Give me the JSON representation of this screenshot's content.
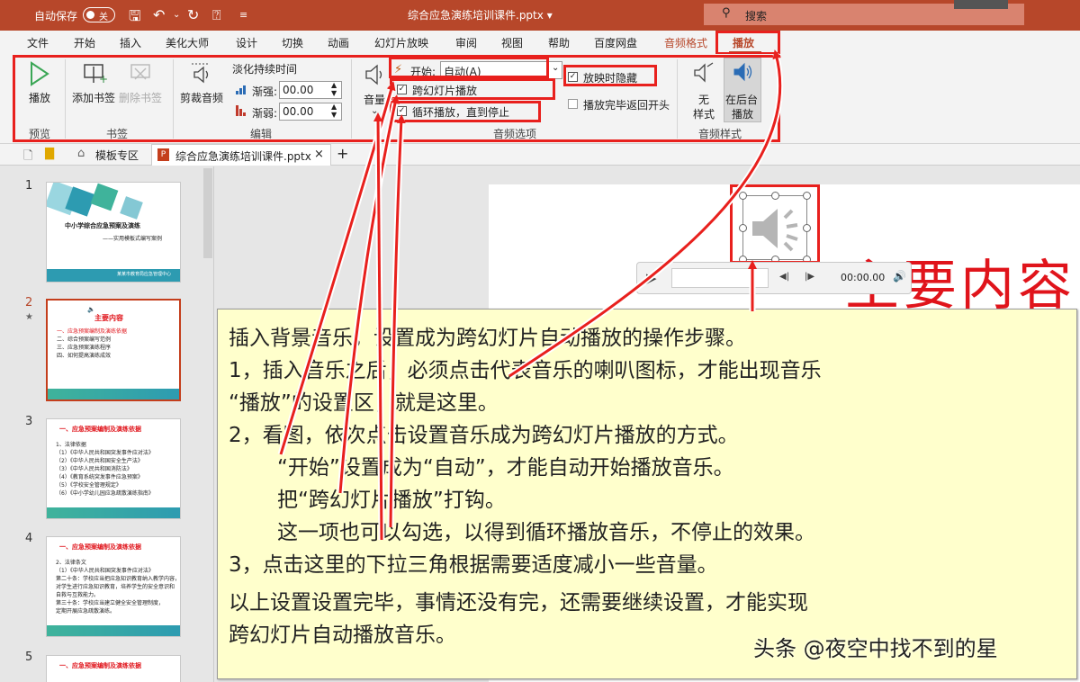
{
  "titlebar": {
    "autosave_label": "自动保存",
    "autosave_state": "关",
    "filename": "综合应急演练培训课件.pptx",
    "filename_chevron": "▾",
    "search_placeholder": "搜索"
  },
  "tabs": [
    {
      "label": "文件"
    },
    {
      "label": "开始"
    },
    {
      "label": "插入"
    },
    {
      "label": "美化大师"
    },
    {
      "label": "设计"
    },
    {
      "label": "切换"
    },
    {
      "label": "动画"
    },
    {
      "label": "幻灯片放映"
    },
    {
      "label": "审阅"
    },
    {
      "label": "视图"
    },
    {
      "label": "帮助"
    },
    {
      "label": "百度网盘"
    },
    {
      "label": "音频格式"
    },
    {
      "label": "播放"
    }
  ],
  "ribbon": {
    "play_label": "播放",
    "preview_group": "预览",
    "add_bookmark": "添加书签",
    "remove_bookmark": "删除书签",
    "bookmark_group": "书签",
    "trim_audio": "剪裁音频",
    "fade_title": "淡化持续时间",
    "fade_in_label": "渐强:",
    "fade_in_value": "00.00",
    "fade_out_label": "渐弱:",
    "fade_out_value": "00.00",
    "edit_group": "编辑",
    "volume_label": "音量",
    "start_label": "开始:",
    "start_value": "自动(A)",
    "play_across_slides": "跨幻灯片播放",
    "loop_until_stopped": "循环播放，直到停止",
    "hide_during_show": "放映时隐藏",
    "rewind_after_playing": "播放完毕返回开头",
    "audio_options_group": "音频选项",
    "no_style": "无\n样式",
    "play_in_background": "在后台\n播放",
    "audio_styles_group": "音频样式"
  },
  "doctabs": {
    "templates": "模板专区",
    "current_file": "综合应急演练培训课件.pptx",
    "new_tab": "+"
  },
  "thumbnails": [
    {
      "number": "1",
      "title": "中小学综合应急预案及演练",
      "subtitle": "——实用模板式编写案例",
      "footer": "某某市教育局应急管理中心"
    },
    {
      "number": "2",
      "title": "主要内容",
      "items": [
        "一、应急预案编制及演练依据",
        "二、综合预案编写范例",
        "三、应急预案演练程序",
        "四、如何提高演练成效"
      ]
    },
    {
      "number": "3",
      "title": "一、应急预案编制及演练依据",
      "items": [
        "1、法律依据",
        "（1）《中华人民共和国突发事件应对法》",
        "（2）《中华人民共和国安全生产法》",
        "（3）《中华人民共和国消防法》",
        "（4）《教育系统突发事件应急预案》",
        "（5）《学校安全管理规定》",
        "（6）《中小学幼儿园应急疏散演练指南》"
      ]
    },
    {
      "number": "4",
      "title": "一、应急预案编制及演练依据",
      "items": [
        "2、法律条文",
        "（1）《中华人民共和国突发事件应对法》",
        "第二十条：学校应当把应急知识教育纳入教学内容，",
        "对学生进行应急知识教育，培养学生的安全意识和",
        "自救与互救能力。",
        "第三十条：学校应当建立健全安全管理制度，",
        "定期开展应急疏散演练。"
      ]
    },
    {
      "number": "5",
      "title": "一、应急预案编制及演练依据"
    }
  ],
  "slide": {
    "title": "主要内容",
    "time": "00:00.00"
  },
  "note": {
    "lines": [
      "插入背景音乐，设置成为跨幻灯片自动播放的操作步骤。",
      "1，插入音乐之后，必须点击代表音乐的喇叭图标，才能出现音乐",
      "“播放”的设置区，就是这里。",
      "2，看图，依次点击设置音乐成为跨幻灯片播放的方式。",
      "“开始”设置成为“自动”，才能自动开始播放音乐。",
      "把“跨幻灯片播放”打钩。",
      "这一项也可以勾选，以得到循环播放音乐，不停止的效果。",
      "3，点击这里的下拉三角根据需要适度减小一些音量。",
      "以上设置设置完毕，事情还没有完，还需要继续设置，才能实现",
      "跨幻灯片自动播放音乐。"
    ]
  },
  "watermark": "头条 @夜空中找不到的星",
  "colors": {
    "accent": "#b7472a",
    "annotation_red": "#e8201d",
    "note_bg": "#ffffcc",
    "slide_title_red": "#e0141b"
  },
  "icons": [
    "save-icon",
    "undo-icon",
    "redo-icon",
    "present-icon",
    "play-icon",
    "bookmark-add-icon",
    "bookmark-remove-icon",
    "trim-icon",
    "volume-icon",
    "speaker-icon"
  ]
}
